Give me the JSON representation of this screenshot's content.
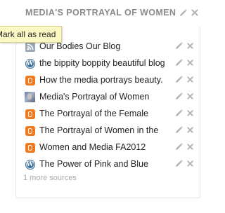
{
  "panel": {
    "title": "MEDIA'S PORTRAYAL OF WOMEN"
  },
  "tooltip": {
    "text": "Mark all as read"
  },
  "sources": [
    {
      "label": "Our Bodies Our Blog",
      "icon": "rss-icon"
    },
    {
      "label": "the bippity boppity beautiful blog",
      "icon": "wordpress-icon"
    },
    {
      "label": "How the media portrays beauty.",
      "icon": "blogger-icon"
    },
    {
      "label": "Media's Portrayal of Women",
      "icon": "avatar-icon"
    },
    {
      "label": "The Portrayal of the Female",
      "icon": "blogger-icon"
    },
    {
      "label": "The Portrayal of Women in the",
      "icon": "blogger-icon"
    },
    {
      "label": "Women and Media FA2012",
      "icon": "blogger-icon"
    },
    {
      "label": "The Power of Pink and Blue",
      "icon": "wordpress-icon"
    }
  ],
  "more_sources": "1 more sources",
  "colors": {
    "blogger": "#f07a1f",
    "wordpress": "#3a6e96",
    "tooltip_bg": "#fbf8c4",
    "muted_text": "#8a8a8a"
  }
}
